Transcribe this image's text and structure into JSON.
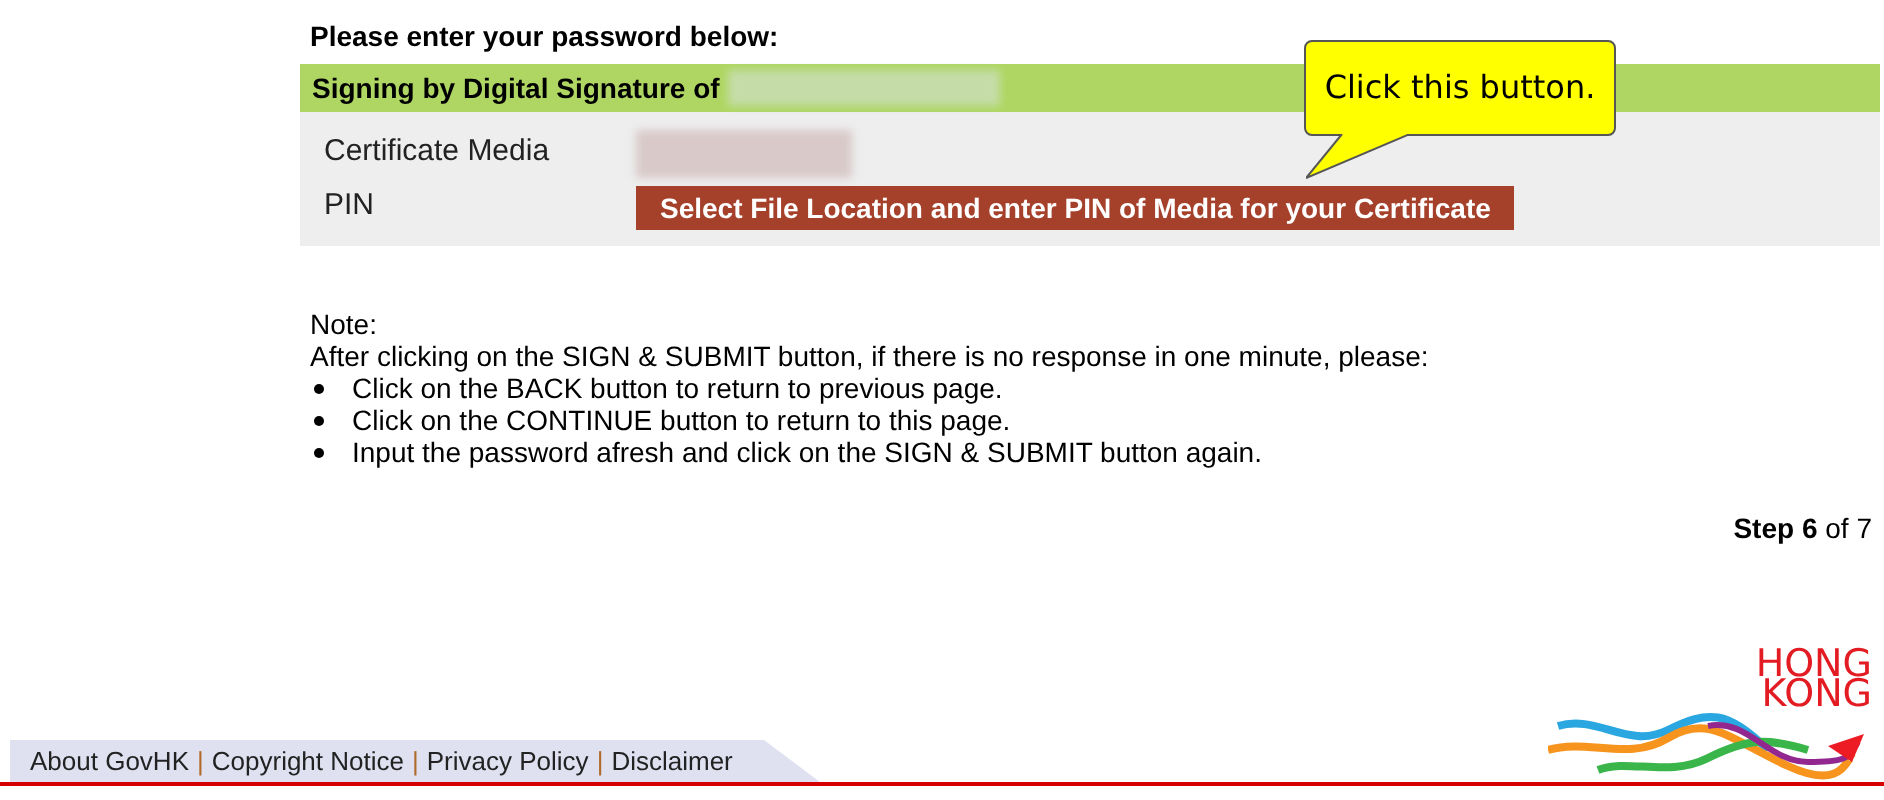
{
  "heading": "Please enter your password below:",
  "signing_bar": {
    "label": "Signing by Digital Signature of"
  },
  "fields": [
    {
      "label": "Certificate Media",
      "kind": "redacted"
    },
    {
      "label": "PIN",
      "kind": "button",
      "button": "Select File Location and enter PIN of Media for your Certificate"
    }
  ],
  "callout": "Click this button.",
  "note": {
    "title": "Note:",
    "intro": "After clicking on the SIGN & SUBMIT button, if there is no response in one minute, please:",
    "items": [
      "Click on the BACK button to return to previous page.",
      "Click on the CONTINUE button to return to this page.",
      "Input the password afresh and click on the SIGN & SUBMIT button again."
    ]
  },
  "step": {
    "word": "Step",
    "current": "6",
    "of": "of",
    "total": "7"
  },
  "logo": {
    "line1": "HONG",
    "line2": "KONG"
  },
  "footer_links": [
    "About GovHK",
    "Copyright Notice",
    "Privacy Policy",
    "Disclaimer"
  ],
  "footer_separator": "|"
}
